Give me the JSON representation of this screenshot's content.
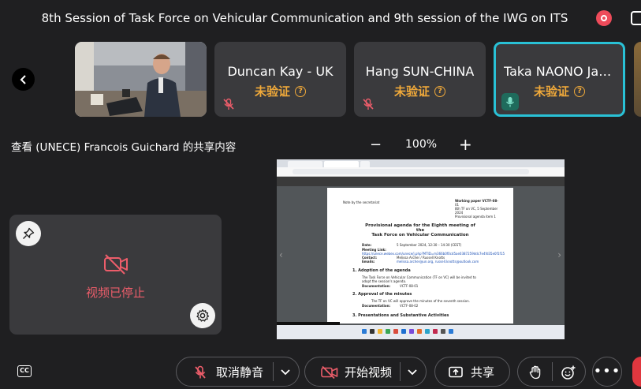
{
  "meeting": {
    "title": "8th Session of Task Force on Vehicular Communication and 9th session of the IWG on ITS"
  },
  "participants": [
    {
      "name": "",
      "has_video": true
    },
    {
      "name": "Duncan Kay - UK",
      "status": "未验证",
      "muted": true
    },
    {
      "name": "Hang SUN-CHINA",
      "status": "未验证",
      "muted": true
    },
    {
      "name": "Taka NAONO Jap...",
      "status": "未验证",
      "muted": false,
      "speaking": true
    }
  ],
  "share": {
    "label": "查看 (UNECE) Francois Guichard 的共享内容",
    "zoom": "100%"
  },
  "self_view": {
    "status": "视频已停止"
  },
  "shared_document": {
    "secretariat_note": "Note by the secretariat",
    "doc_ref_lines": [
      "Working paper VCTF-08-",
      "01",
      "8th TF on VC, 5 September",
      "2024",
      "Provisional agenda item 1"
    ],
    "title_lines": [
      "Provisional agenda for the Eighth meeting of",
      "the",
      "Task Force on Vehicular Communication"
    ],
    "details": [
      {
        "key": "Date:",
        "value": "5 September 2024, 12:30 – 14:30 (CEST)"
      },
      {
        "key": "Meeting Link:",
        "value": ""
      },
      {
        "key": "",
        "value": "https://unece.webex.com/unece/j.php?MTID=m366b0f0cd5ae0387259ddc7e4fd35e0f1f15"
      },
      {
        "key": "Contact:",
        "value": "Melissa Archer / Russell Knotts"
      },
      {
        "key": "Emails:",
        "value": "melissa.archer@un.org, russell.knotts@outlook.com"
      }
    ],
    "sections": [
      {
        "heading": "1.    Adoption of the agenda",
        "text": [
          "The Task Force on Vehicular Communication (TF on VC) will be invited to",
          "adopt the session's agenda."
        ],
        "doc": "VCTF-08-01"
      },
      {
        "heading": "2.    Approval of the minutes",
        "text": [
          "The TF on VC will approve the minutes of the seventh session."
        ],
        "doc": "VCTF-08-02"
      },
      {
        "heading": "3.    Presentations and Substantive Activities",
        "text": [],
        "doc": ""
      }
    ],
    "documentation_label": "Documentation:"
  },
  "toolbar": {
    "cc_label": "CC",
    "unmute_label": "取消静音",
    "start_video_label": "开始视频",
    "share_label": "共享"
  },
  "colors": {
    "accent_teal": "#29c1d6",
    "warning_orange": "#f0a93a",
    "stop_red": "#ec5d6a",
    "record_red": "#ee4b5a"
  }
}
